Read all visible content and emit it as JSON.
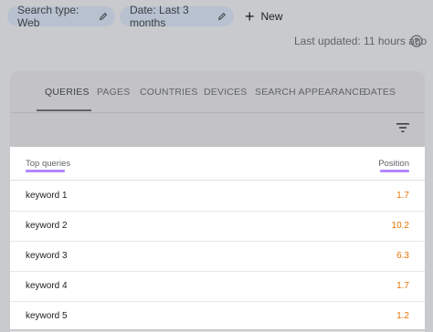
{
  "filters": {
    "search_type": "Search type: Web",
    "date": "Date: Last 3 months",
    "new_label": "New"
  },
  "last_updated": "Last updated: 11 hours ago",
  "tabs": [
    {
      "label": "QUERIES",
      "active": true
    },
    {
      "label": "PAGES"
    },
    {
      "label": "COUNTRIES"
    },
    {
      "label": "DEVICES"
    },
    {
      "label": "SEARCH APPEARANCE"
    },
    {
      "label": "DATES"
    }
  ],
  "table": {
    "col_query": "Top queries",
    "col_position": "Position",
    "rows": [
      {
        "query": "keyword 1",
        "position": "1.7"
      },
      {
        "query": "keyword 2",
        "position": "10.2"
      },
      {
        "query": "keyword 3",
        "position": "6.3"
      },
      {
        "query": "keyword 4",
        "position": "1.7"
      },
      {
        "query": "keyword 5",
        "position": "1.2"
      }
    ]
  },
  "colors": {
    "position_value": "#e37400",
    "highlight": "#b388ff",
    "chip_bg": "#b8c1cf"
  },
  "icons": [
    "pencil-icon",
    "plus-icon",
    "help-icon",
    "filter-icon"
  ]
}
